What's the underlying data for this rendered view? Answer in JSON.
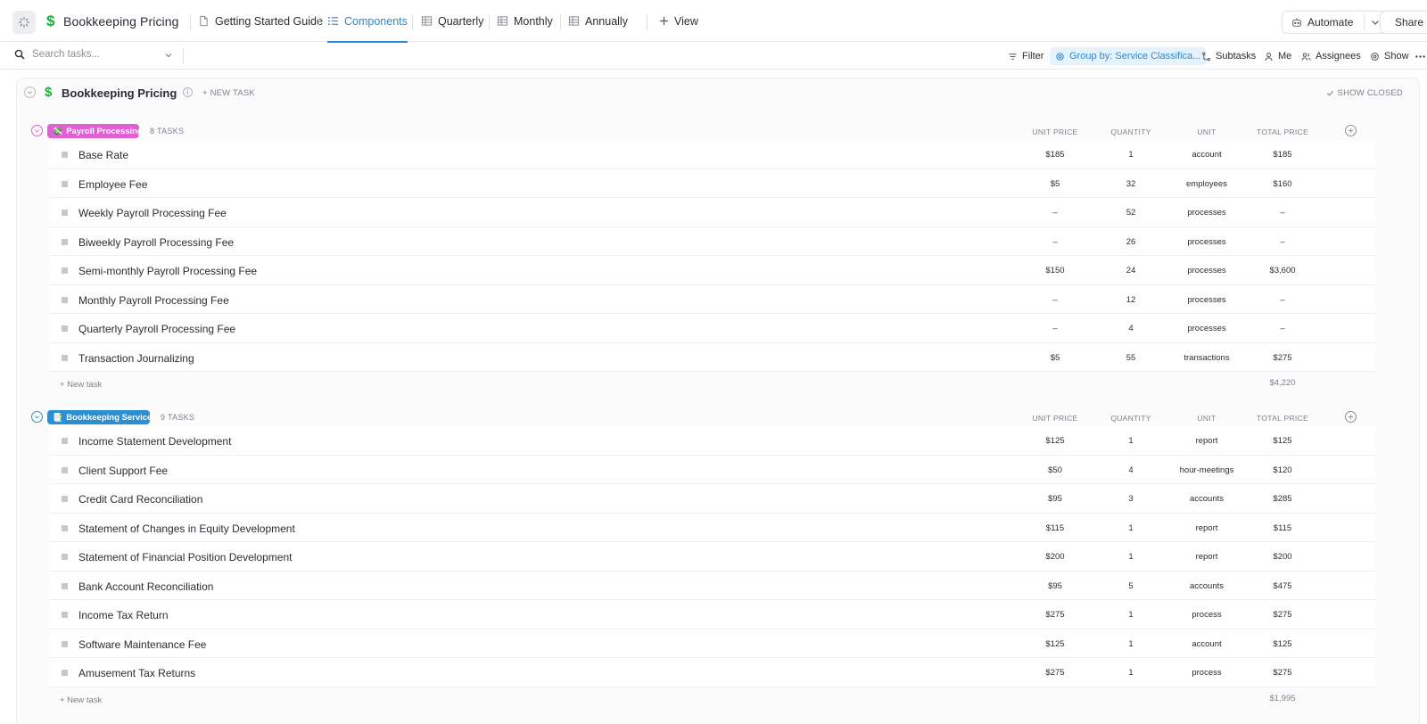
{
  "header": {
    "title": "Bookkeeping Pricing",
    "title_icon": "$",
    "tabs": [
      {
        "label": "Getting Started Guide",
        "icon": "doc-icon",
        "active": false
      },
      {
        "label": "Components",
        "icon": "list-icon",
        "active": true
      },
      {
        "label": "Quarterly",
        "icon": "table-icon",
        "active": false
      },
      {
        "label": "Monthly",
        "icon": "table-icon",
        "active": false
      },
      {
        "label": "Annually",
        "icon": "table-icon",
        "active": false
      }
    ],
    "add_view_label": "View",
    "automate_label": "Automate",
    "share_label": "Share"
  },
  "toolbar": {
    "search_placeholder": "Search tasks...",
    "filter_label": "Filter",
    "group_by_label": "Group by: Service Classifica...",
    "subtasks_label": "Subtasks",
    "me_label": "Me",
    "assignees_label": "Assignees",
    "show_label": "Show"
  },
  "list": {
    "title": "Bookkeeping Pricing",
    "title_icon": "$",
    "new_task_label": "+ NEW TASK",
    "show_closed_label": "SHOW CLOSED",
    "columns": {
      "unit_price": "UNIT PRICE",
      "quantity": "QUANTITY",
      "unit": "UNIT",
      "total_price": "TOTAL PRICE"
    },
    "groups": [
      {
        "name": "Payroll Processing",
        "icon": "💸",
        "color": "#e05fd3",
        "task_count": "8 TASKS",
        "new_task_label": "+ New task",
        "total": "$4,220",
        "tasks": [
          {
            "name": "Base Rate",
            "unit_price": "$185",
            "quantity": "1",
            "unit": "account",
            "total": "$185"
          },
          {
            "name": "Employee Fee",
            "unit_price": "$5",
            "quantity": "32",
            "unit": "employees",
            "total": "$160"
          },
          {
            "name": "Weekly Payroll Processing Fee",
            "unit_price": "–",
            "quantity": "52",
            "unit": "processes",
            "total": "–"
          },
          {
            "name": "Biweekly Payroll Processing Fee",
            "unit_price": "–",
            "quantity": "26",
            "unit": "processes",
            "total": "–"
          },
          {
            "name": "Semi-monthly Payroll Processing Fee",
            "unit_price": "$150",
            "quantity": "24",
            "unit": "processes",
            "total": "$3,600"
          },
          {
            "name": "Monthly Payroll Processing Fee",
            "unit_price": "–",
            "quantity": "12",
            "unit": "processes",
            "total": "–"
          },
          {
            "name": "Quarterly Payroll Processing Fee",
            "unit_price": "–",
            "quantity": "4",
            "unit": "processes",
            "total": "–"
          },
          {
            "name": "Transaction Journalizing",
            "unit_price": "$5",
            "quantity": "55",
            "unit": "transactions",
            "total": "$275"
          }
        ]
      },
      {
        "name": "Bookkeeping Service",
        "icon": "📑",
        "color": "#2b8fd6",
        "task_count": "9 TASKS",
        "new_task_label": "+ New task",
        "total": "$1,995",
        "tasks": [
          {
            "name": "Income Statement Development",
            "unit_price": "$125",
            "quantity": "1",
            "unit": "report",
            "total": "$125"
          },
          {
            "name": "Client Support Fee",
            "unit_price": "$50",
            "quantity": "4",
            "unit": "hour-meetings",
            "total": "$120"
          },
          {
            "name": "Credit Card Reconciliation",
            "unit_price": "$95",
            "quantity": "3",
            "unit": "accounts",
            "total": "$285"
          },
          {
            "name": "Statement of Changes in Equity Development",
            "unit_price": "$115",
            "quantity": "1",
            "unit": "report",
            "total": "$115"
          },
          {
            "name": "Statement of Financial Position Development",
            "unit_price": "$200",
            "quantity": "1",
            "unit": "report",
            "total": "$200"
          },
          {
            "name": "Bank Account Reconciliation",
            "unit_price": "$95",
            "quantity": "5",
            "unit": "accounts",
            "total": "$475"
          },
          {
            "name": "Income Tax Return",
            "unit_price": "$275",
            "quantity": "1",
            "unit": "process",
            "total": "$275"
          },
          {
            "name": "Software Maintenance Fee",
            "unit_price": "$125",
            "quantity": "1",
            "unit": "account",
            "total": "$125"
          },
          {
            "name": "Amusement Tax Returns",
            "unit_price": "$275",
            "quantity": "1",
            "unit": "process",
            "total": "$275"
          }
        ]
      }
    ]
  }
}
